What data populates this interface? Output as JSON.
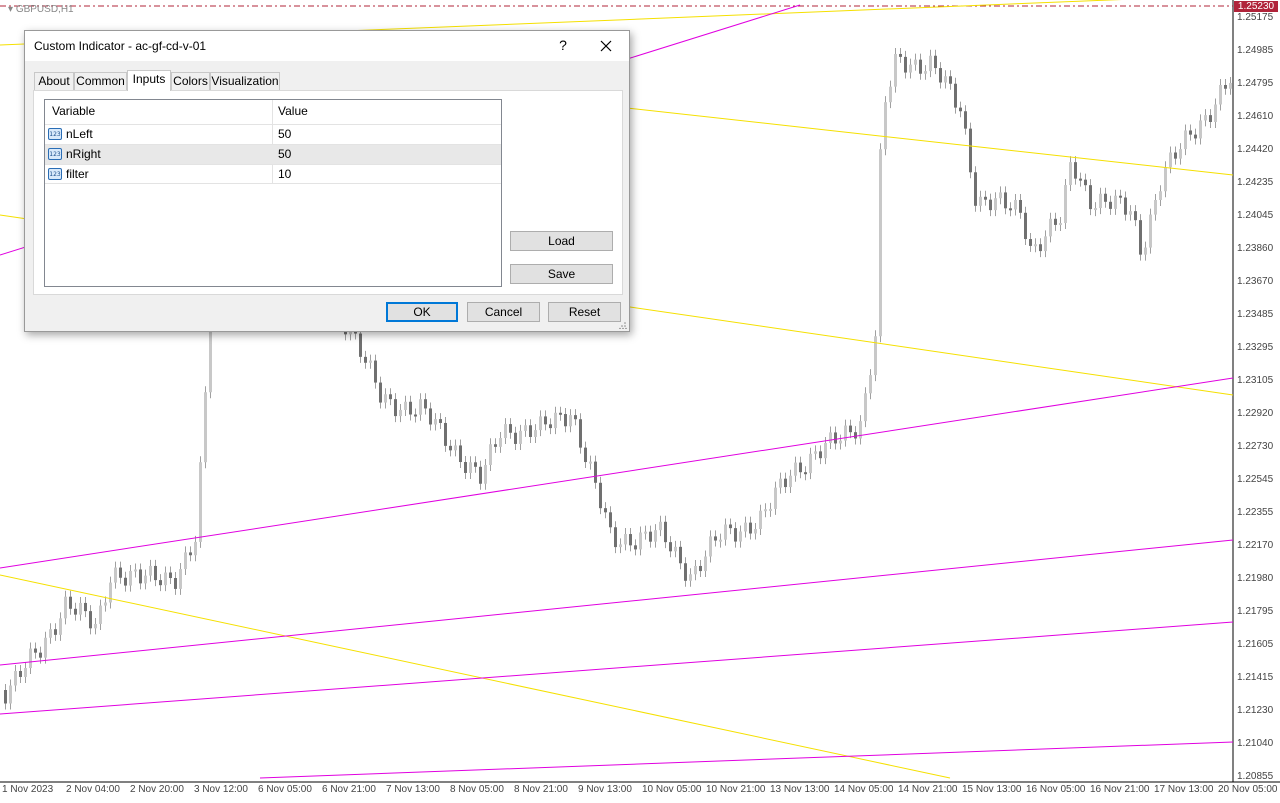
{
  "chart": {
    "symbol": "GBPUSD,H1",
    "current_price": "1.25230",
    "price_axis": [
      "1.25175",
      "1.24985",
      "1.24795",
      "1.24610",
      "1.24420",
      "1.24235",
      "1.24045",
      "1.23860",
      "1.23670",
      "1.23485",
      "1.23295",
      "1.23105",
      "1.22920",
      "1.22730",
      "1.22545",
      "1.22355",
      "1.22170",
      "1.21980",
      "1.21795",
      "1.21605",
      "1.21415",
      "1.21230",
      "1.21040",
      "1.20855"
    ],
    "time_axis": [
      "1 Nov 2023",
      "2 Nov 04:00",
      "2 Nov 20:00",
      "3 Nov 12:00",
      "6 Nov 05:00",
      "6 Nov 21:00",
      "7 Nov 13:00",
      "8 Nov 05:00",
      "8 Nov 21:00",
      "9 Nov 13:00",
      "10 Nov 05:00",
      "10 Nov 21:00",
      "13 Nov 13:00",
      "14 Nov 05:00",
      "14 Nov 21:00",
      "15 Nov 13:00",
      "16 Nov 05:00",
      "16 Nov 21:00",
      "17 Nov 13:00",
      "20 Nov 05:00"
    ],
    "colors": {
      "uptrend": "#e000e0",
      "downtrend": "#f5e000",
      "candle_up": "#c8c8c8",
      "candle_down": "#707070",
      "badge": "#b0243a"
    }
  },
  "dialog": {
    "title": "Custom Indicator - ac-gf-cd-v-01",
    "help_label": "?",
    "tabs": [
      {
        "label": "About",
        "active": false
      },
      {
        "label": "Common",
        "active": false
      },
      {
        "label": "Inputs",
        "active": true
      },
      {
        "label": "Colors",
        "active": false
      },
      {
        "label": "Visualization",
        "active": false
      }
    ],
    "columns": {
      "variable": "Variable",
      "value": "Value"
    },
    "inputs": [
      {
        "icon": "123",
        "name": "nLeft",
        "value": "50"
      },
      {
        "icon": "123",
        "name": "nRight",
        "value": "50"
      },
      {
        "icon": "123",
        "name": "filter",
        "value": "10"
      }
    ],
    "selected_row": 1,
    "buttons": {
      "load": "Load",
      "save": "Save",
      "ok": "OK",
      "cancel": "Cancel",
      "reset": "Reset"
    }
  }
}
